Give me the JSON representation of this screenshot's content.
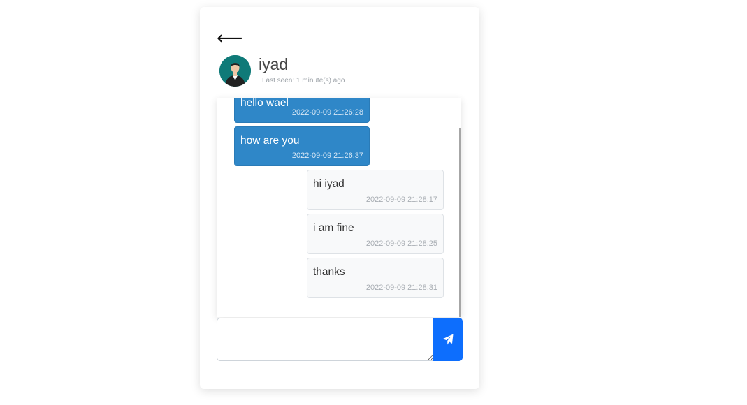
{
  "header": {
    "back_icon": "arrow-left-icon",
    "back_glyph": "⟵",
    "name": "iyad",
    "last_seen": "Last seen: 1 minute(s) ago"
  },
  "messages": [
    {
      "text": "hello wael",
      "time": "2022-09-09 21:26:28",
      "side": "sent"
    },
    {
      "text": "how are you",
      "time": "2022-09-09 21:26:37",
      "side": "sent"
    },
    {
      "text": "hi iyad",
      "time": "2022-09-09 21:28:17",
      "side": "received"
    },
    {
      "text": "i am fine",
      "time": "2022-09-09 21:28:25",
      "side": "received"
    },
    {
      "text": "thanks",
      "time": "2022-09-09 21:28:31",
      "side": "received"
    }
  ],
  "composer": {
    "value": "",
    "send_icon": "paper-plane-icon"
  },
  "colors": {
    "sent_bubble": "#2f87c8",
    "received_bubble": "#f8f9fa",
    "send_button": "#0d6efd",
    "avatar_bg": "#0f7a78"
  }
}
